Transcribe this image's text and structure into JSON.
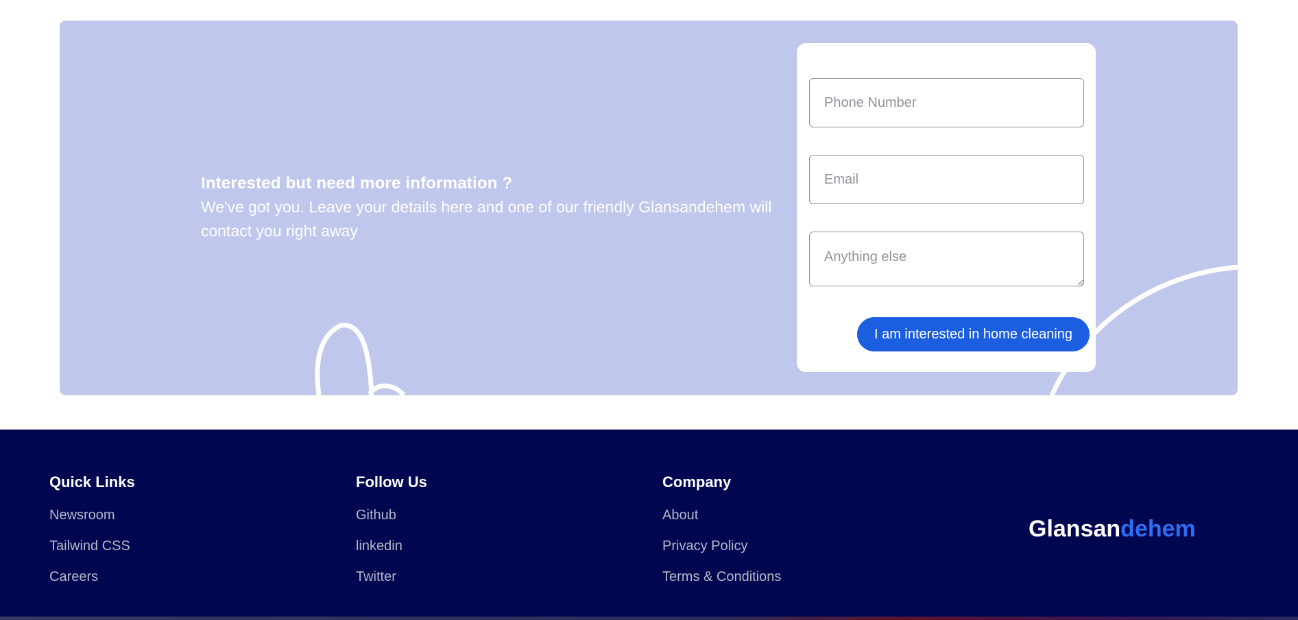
{
  "cta": {
    "heading": "Interested but need more information ?",
    "body": "We've got you. Leave your details here and one of our friendly Glansandehem will contact you right away",
    "background_color": "#bfc7ed",
    "form": {
      "phone_placeholder": "Phone Number",
      "email_placeholder": "Email",
      "message_placeholder": "Anything else",
      "submit_label": "I am interested in home cleaning",
      "submit_color": "#1b5fe0"
    }
  },
  "footer": {
    "background_color": "#000650",
    "columns": [
      {
        "title": "Quick Links",
        "links": [
          "Newsroom",
          "Tailwind CSS",
          "Careers"
        ]
      },
      {
        "title": "Follow Us",
        "links": [
          "Github",
          "linkedin",
          "Twitter"
        ]
      },
      {
        "title": "Company",
        "links": [
          "About",
          "Privacy Policy",
          "Terms & Conditions"
        ]
      }
    ],
    "brand": {
      "part1": "Glansan",
      "part2": "dehem",
      "accent_color": "#2f6df2"
    }
  }
}
